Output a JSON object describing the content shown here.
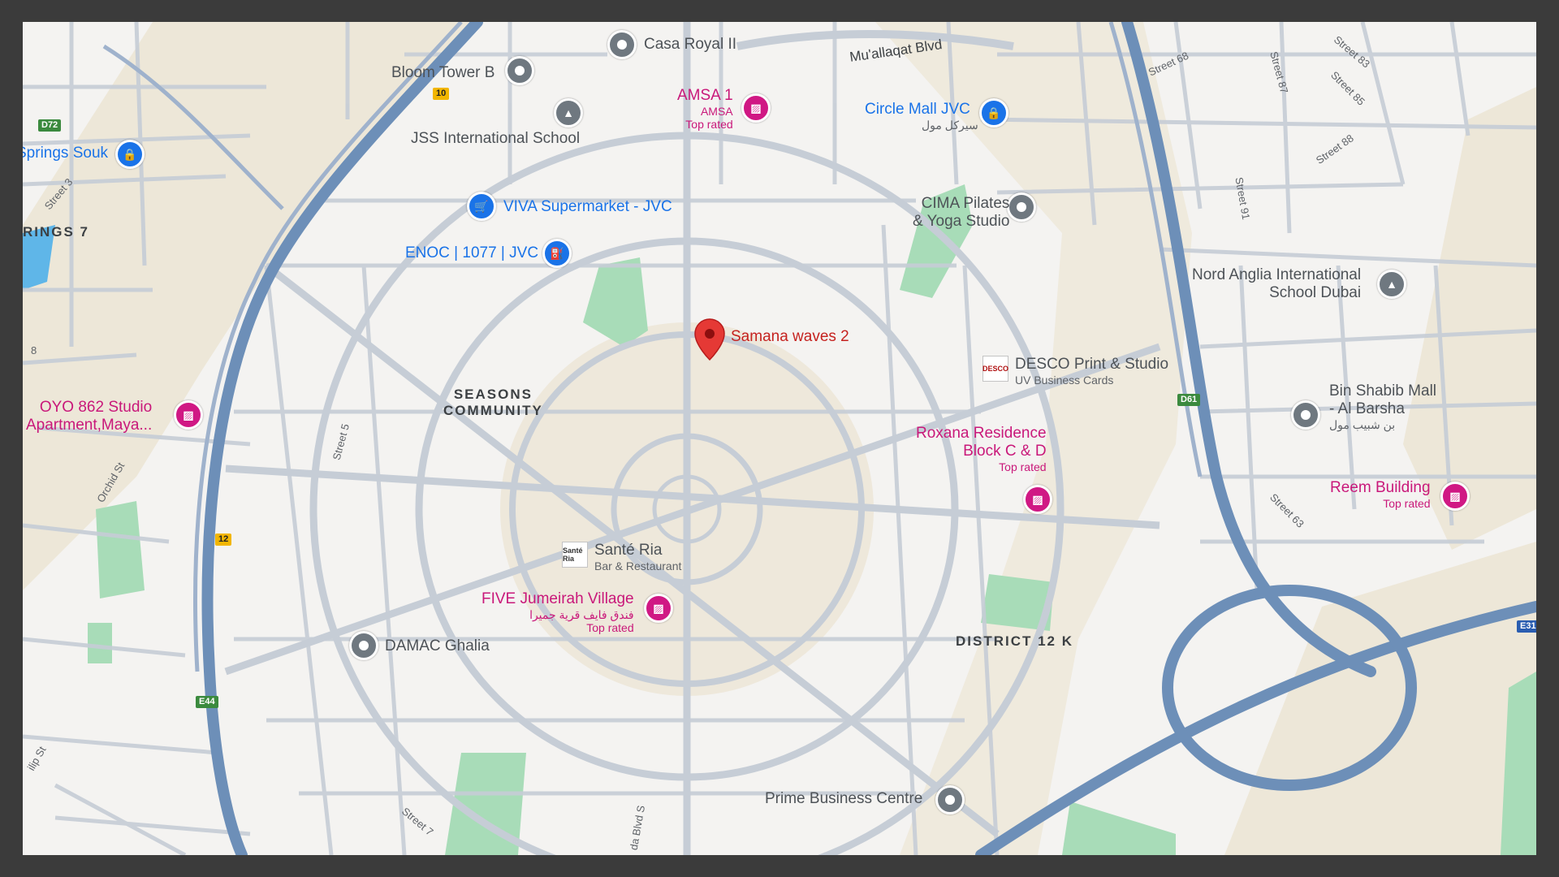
{
  "map": {
    "colors": {
      "land": "#f4f3f1",
      "urban": "#ede7d8",
      "park": "#a8dcb8",
      "road": "#c6cdd6",
      "highway": "#6d8fb8",
      "pin_red": "#e53935",
      "poi_blue": "#1a73e8",
      "poi_pink": "#d01884",
      "poi_grey": "#6f7880"
    },
    "selected_place": {
      "label": "Samana waves 2",
      "icon": "red-map-pin-icon"
    },
    "areas": {
      "seasons": [
        "SEASONS",
        "COMMUNITY"
      ],
      "district12k": "DISTRICT 12 K",
      "springs7": "RINGS 7"
    },
    "roads": {
      "muallaqat": "Mu'allaqat Blvd",
      "orchid": "Orchid St",
      "street5": "Street 5",
      "street7": "Street 7",
      "street3": "Street 3",
      "street68": "Street 68",
      "street87": "Street 87",
      "street83": "Street 83",
      "street85": "Street 85",
      "street88": "Street 88",
      "street91": "Street 91",
      "street63": "Street 63",
      "blvd_s": "da Blvd S",
      "lip": "ilip St",
      "eight": "8"
    },
    "shields": {
      "d72": "D72",
      "r10": "10",
      "r12": "12",
      "e44": "E44",
      "d61": "D61",
      "e31": "E31"
    },
    "pois": {
      "casa_royal": {
        "name": "Casa Royal II",
        "icon": "landmark-icon"
      },
      "bloom_tower": {
        "name": "Bloom Tower B",
        "icon": "landmark-icon"
      },
      "jss": {
        "name": "JSS International School",
        "icon": "school-icon"
      },
      "amsa": {
        "name": "AMSA 1",
        "sub1": "AMSA",
        "sub2": "Top rated",
        "icon": "hotel-icon"
      },
      "circle_mall": {
        "name": "Circle Mall JVC",
        "sub1": "سيركل مول",
        "icon": "shopping-bag-icon"
      },
      "springs_souk": {
        "name": "Springs Souk",
        "icon": "shopping-bag-icon"
      },
      "viva": {
        "name": "VIVA Supermarket - JVC",
        "icon": "shopping-cart-icon"
      },
      "cima": {
        "name1": "CIMA Pilates",
        "name2": "& Yoga Studio",
        "icon": "landmark-icon"
      },
      "enoc": {
        "name": "ENOC | 1077 | JVC",
        "icon": "fuel-icon"
      },
      "nord_anglia": {
        "name1": "Nord Anglia International",
        "name2": "School Dubai",
        "icon": "school-icon"
      },
      "oyo": {
        "name1": "OYO 862 Studio",
        "name2": "Apartment,Maya...",
        "icon": "hotel-icon"
      },
      "desco": {
        "name": "DESCO Print & Studio",
        "sub1": "UV Business Cards",
        "logo": "DESCO"
      },
      "bin_shabib": {
        "name1": "Bin Shabib Mall",
        "name2": "- Al Barsha",
        "sub1": "بن شبيب مول",
        "icon": "landmark-icon"
      },
      "roxana": {
        "name1": "Roxana Residence",
        "name2": "Block C & D",
        "sub1": "Top rated",
        "icon": "hotel-icon"
      },
      "reem": {
        "name": "Reem Building",
        "sub1": "Top rated",
        "icon": "hotel-icon"
      },
      "sante_ria": {
        "name": "Santé Ria",
        "sub1": "Bar & Restaurant",
        "logo": "Santé Ria"
      },
      "five": {
        "name": "FIVE Jumeirah Village",
        "sub1": "فندق فايف قرية جميرا",
        "sub2": "Top rated",
        "icon": "hotel-icon"
      },
      "damac": {
        "name": "DAMAC Ghalia",
        "icon": "landmark-icon"
      },
      "prime": {
        "name": "Prime Business Centre",
        "icon": "landmark-icon"
      }
    }
  }
}
